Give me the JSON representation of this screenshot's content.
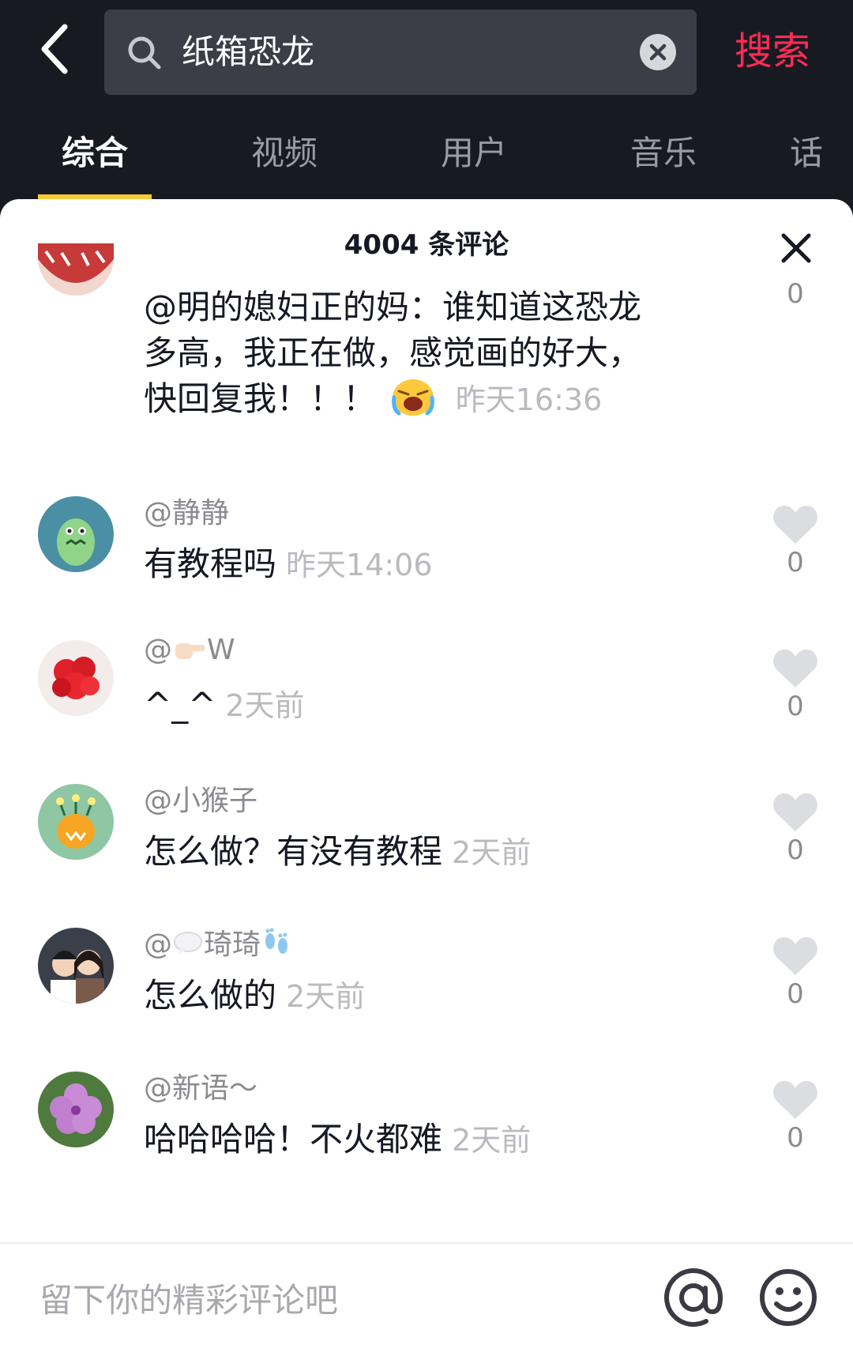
{
  "search": {
    "query": "纸箱恐龙",
    "button_label": "搜索"
  },
  "tabs": [
    {
      "label": "综合",
      "active": true
    },
    {
      "label": "视频",
      "active": false
    },
    {
      "label": "用户",
      "active": false
    },
    {
      "label": "音乐",
      "active": false
    },
    {
      "label": "话",
      "active": false
    }
  ],
  "comment_panel": {
    "title": "4004 条评论"
  },
  "comments": [
    {
      "username": "",
      "lines": [
        "@明的媳妇正的妈：谁知道这恐龙",
        "多高，我正在做，感觉画的好大，",
        "快回复我！！！"
      ],
      "emoji": "loudly-crying-face",
      "time": "昨天16:36",
      "likes": "0"
    },
    {
      "username": "@静静",
      "text": "有教程吗",
      "time": "昨天14:06",
      "likes": "0"
    },
    {
      "username": "@",
      "username_suffix": "W",
      "username_emoji": "pointing-hand",
      "text": "^_^",
      "time": "2天前",
      "likes": "0"
    },
    {
      "username": "@小猴子",
      "text": "怎么做？有没有教程",
      "time": "2天前",
      "likes": "0"
    },
    {
      "username": "@",
      "username_suffix": "琦琦",
      "username_emoji": "speech-bubble, footprints",
      "text": "怎么做的",
      "time": "2天前",
      "likes": "0"
    },
    {
      "username": "@新语～",
      "text": "哈哈哈哈！不火都难",
      "time": "2天前",
      "likes": "0"
    }
  ],
  "input": {
    "placeholder": "留下你的精彩评论吧"
  },
  "colors": {
    "accent_red": "#fe2c55",
    "tab_indicator": "#f7c937",
    "background_dark": "#181a22"
  }
}
